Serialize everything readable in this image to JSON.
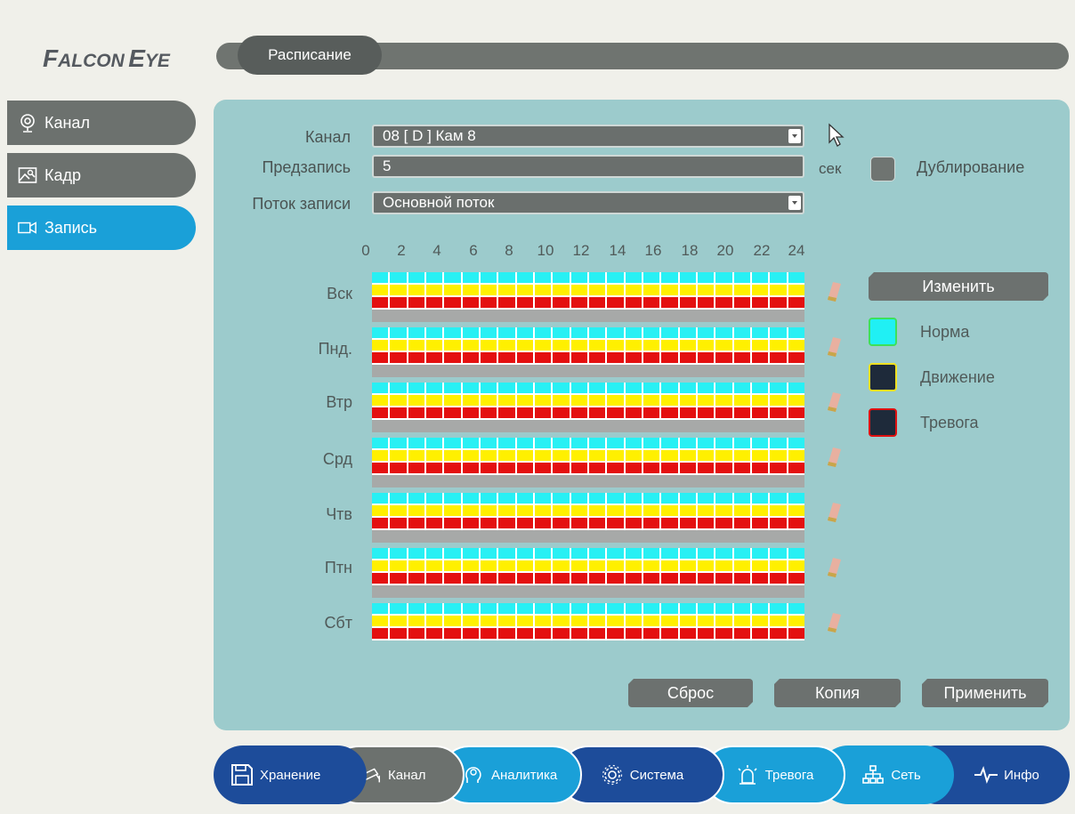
{
  "brand": {
    "logo_part1": "F",
    "logo_part2": "ALCON",
    "logo_part3": "E",
    "logo_part4": "YE"
  },
  "header": {
    "title": "Расписание"
  },
  "sidebar": {
    "items": [
      {
        "label": "Канал",
        "icon": "camera-channel-icon",
        "active": false
      },
      {
        "label": "Кадр",
        "icon": "image-frame-icon",
        "active": false
      },
      {
        "label": "Запись",
        "icon": "video-record-icon",
        "active": true
      }
    ]
  },
  "form": {
    "channel_label": "Канал",
    "channel_value": "08 [ D ] Кам 8",
    "prerecord_label": "Предзапись",
    "prerecord_value": "5",
    "prerecord_unit": "сек",
    "duplicate_label": "Дублирование",
    "stream_label": "Поток записи",
    "stream_value": "Основной поток"
  },
  "schedule": {
    "hours": [
      "0",
      "2",
      "4",
      "6",
      "8",
      "10",
      "12",
      "14",
      "16",
      "18",
      "20",
      "22",
      "24"
    ],
    "days": [
      "Вск",
      "Пнд.",
      "Втр",
      "Срд",
      "Чтв",
      "Птн",
      "Сбт"
    ]
  },
  "legend": {
    "edit_label": "Изменить",
    "items": [
      {
        "label": "Норма",
        "fill": "#20f0f4",
        "border": "#3de05a"
      },
      {
        "label": "Движение",
        "fill": "#1e2a3a",
        "border": "#f0e020"
      },
      {
        "label": "Тревога",
        "fill": "#1e2a3a",
        "border": "#e01010"
      }
    ]
  },
  "actions": {
    "reset": "Сброс",
    "copy": "Копия",
    "apply": "Применить"
  },
  "bottom_nav": [
    {
      "label": "Хранение",
      "icon": "save-disk-icon"
    },
    {
      "label": "Канал",
      "icon": "cctv-camera-icon"
    },
    {
      "label": "Аналитика",
      "icon": "brain-analytics-icon"
    },
    {
      "label": "Система",
      "icon": "gear-icon"
    },
    {
      "label": "Тревога",
      "icon": "alarm-light-icon"
    },
    {
      "label": "Сеть",
      "icon": "network-icon"
    },
    {
      "label": "Инфо",
      "icon": "pulse-info-icon"
    }
  ],
  "colors": {
    "accent": "#1aa0d8",
    "panel": "#9ccbcc",
    "normal": "#28f0f4",
    "motion": "#fff000",
    "alarm": "#e41010"
  }
}
